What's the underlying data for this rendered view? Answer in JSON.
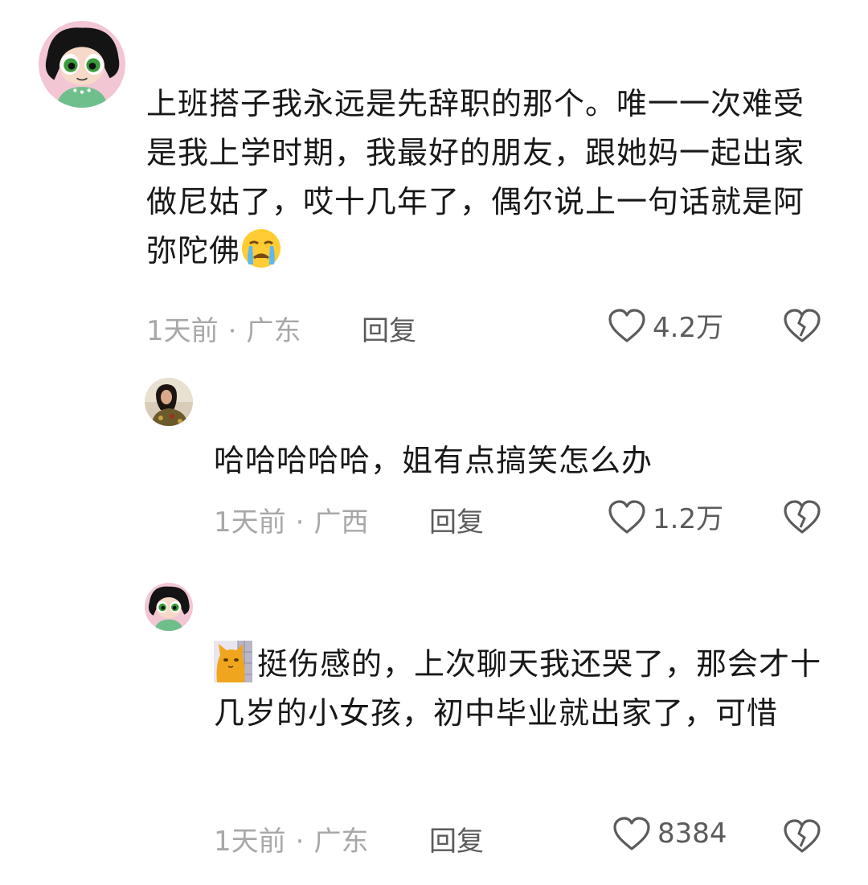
{
  "comments": [
    {
      "text": "上班搭子我永远是先辞职的那个。唯一一次难受是我上学时期，我最好的朋友，跟她妈一起出家做尼姑了，哎十几年了，偶尔说上一句话就是阿弥陀佛",
      "emoji": "crying-face-icon",
      "time": "1天前",
      "location": "广东",
      "reply_label": "回复",
      "likes": "4.2万"
    },
    {
      "text": "哈哈哈哈哈，姐有点搞笑怎么办",
      "time": "1天前",
      "location": "广西",
      "reply_label": "回复",
      "likes": "1.2万"
    },
    {
      "sticker": "cat-sticker-icon",
      "text": "挺伤感的，上次聊天我还哭了，那会才十几岁的小女孩，初中毕业就出家了，可惜",
      "time": "1天前",
      "location": "广东",
      "reply_label": "回复",
      "likes": "8384"
    }
  ],
  "separator": "·",
  "colors": {
    "text": "#181818",
    "meta": "#a8a8a8",
    "action": "#5b5b5b"
  }
}
